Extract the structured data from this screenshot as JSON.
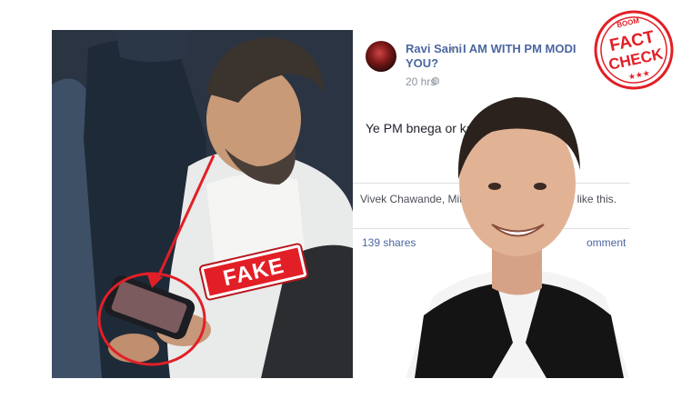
{
  "post": {
    "author": "Ravi Saini",
    "group_line1": "I AM WITH PM MODI",
    "group_line2": "YOU?",
    "time": "20 hrs",
    "text": "Ye PM bnega or ka",
    "likes": "Vivek Chawande, Mithl                          ndge and 186 others like this.",
    "shares": "139 shares",
    "comments": "omment"
  },
  "stamp": {
    "fake": "FAKE"
  },
  "seal": {
    "brand": "BOOM",
    "line1": "FACT",
    "line2": "CHECK",
    "stars": "★★★"
  },
  "icons": {
    "arrow": "▸",
    "globe": "◍"
  },
  "colors": {
    "fb_blue": "#4b67a1",
    "stamp_red": "#e21f26",
    "muted": "#8d949e"
  }
}
